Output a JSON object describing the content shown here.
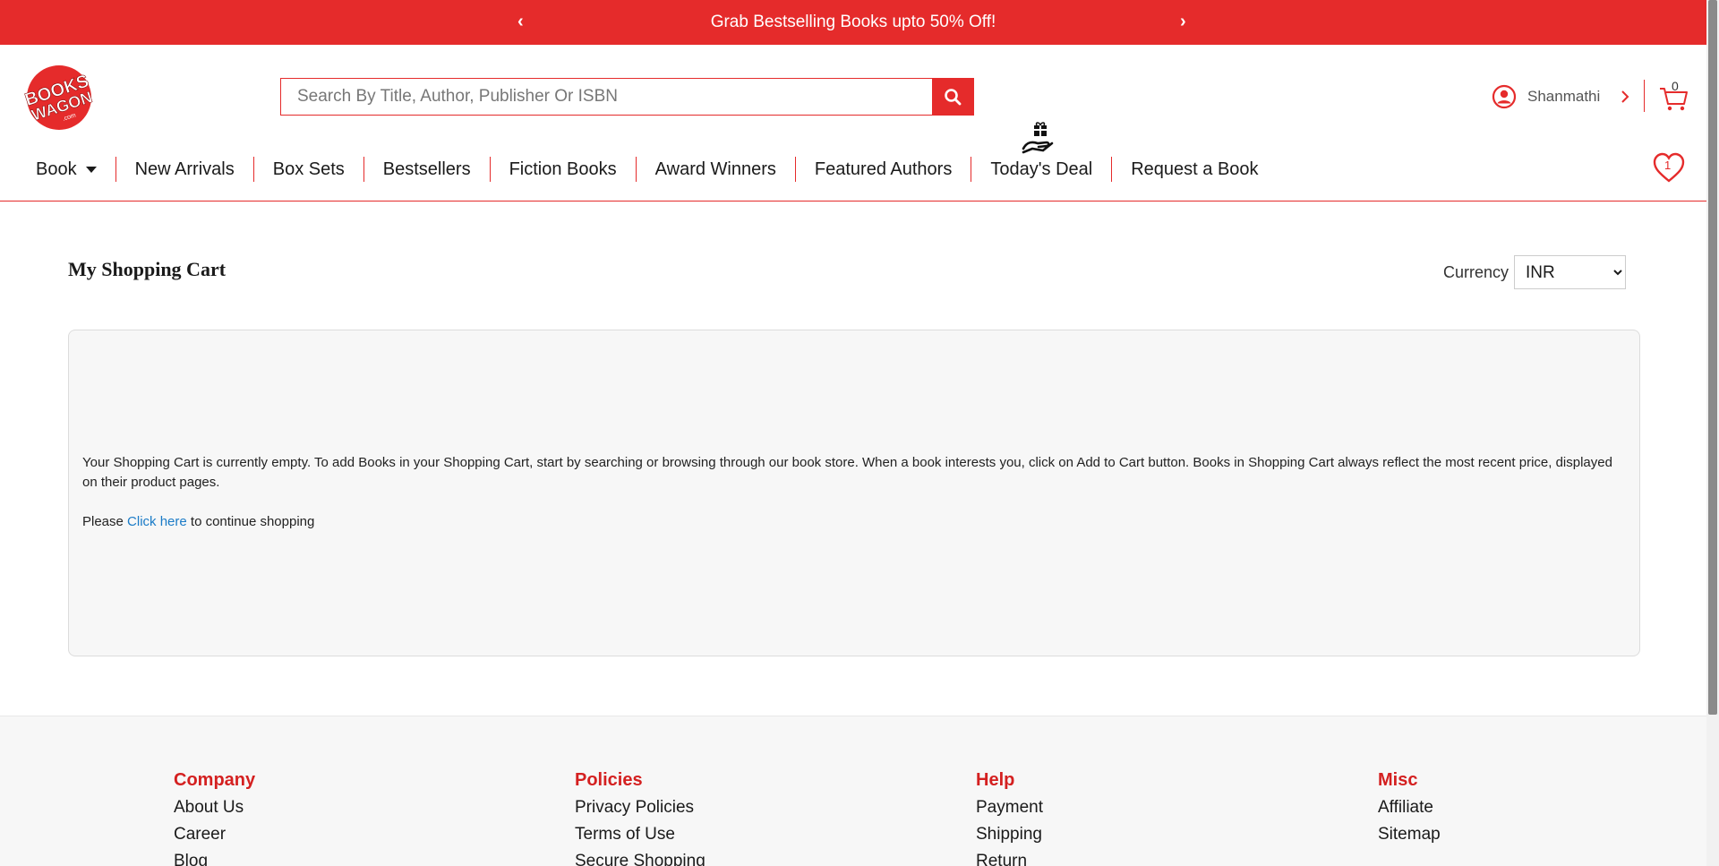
{
  "promo": {
    "text": "Grab Bestselling Books upto 50% Off!",
    "prev_icon": "‹",
    "next_icon": "›"
  },
  "header": {
    "logo_line1": "BOOKS",
    "logo_line2": "WAGON",
    "logo_suffix": ".com",
    "search_placeholder": "Search By Title, Author, Publisher Or ISBN",
    "user_name": "Shanmathi",
    "cart_count": "0",
    "wishlist_count": "1"
  },
  "nav": {
    "items": [
      "Book",
      "New Arrivals",
      "Box Sets",
      "Bestsellers",
      "Fiction Books",
      "Award Winners",
      "Featured Authors",
      "Today's Deal",
      "Request a Book"
    ]
  },
  "main": {
    "title": "My Shopping Cart",
    "currency_label": "Currency",
    "currency_value": "INR",
    "empty_message": "Your Shopping Cart is currently empty. To add Books in your Shopping Cart, start by searching or browsing through our book store. When a book interests you, click on Add to Cart button. Books in Shopping Cart always reflect the most recent price, displayed on their product pages.",
    "continue_prefix": "Please ",
    "continue_link": "Click here",
    "continue_suffix": " to continue shopping"
  },
  "footer": {
    "columns": [
      {
        "heading": "Company",
        "links": [
          "About Us",
          "Career",
          "Blog"
        ]
      },
      {
        "heading": "Policies",
        "links": [
          "Privacy Policies",
          "Terms of Use",
          "Secure Shopping"
        ]
      },
      {
        "heading": "Help",
        "links": [
          "Payment",
          "Shipping",
          "Return"
        ]
      },
      {
        "heading": "Misc",
        "links": [
          "Affiliate",
          "Sitemap"
        ]
      }
    ]
  },
  "colors": {
    "brand_red": "#e52b2b",
    "link_blue": "#1a7bc7"
  }
}
